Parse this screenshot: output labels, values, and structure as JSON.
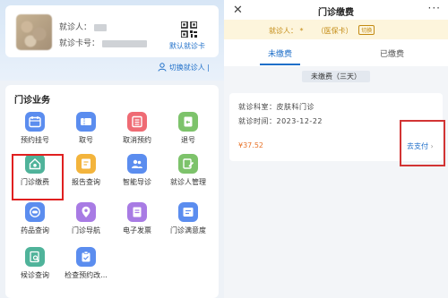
{
  "left": {
    "patient": {
      "name_label": "就诊人：",
      "card_label": "就诊卡号：",
      "qr_label": "默认就诊卡"
    },
    "switch_patient": "切换就诊人",
    "services_title": "门诊业务",
    "services": [
      {
        "label": "预约挂号",
        "icon": "calendar-icon",
        "color": "#5b8def"
      },
      {
        "label": "取号",
        "icon": "ticket-icon",
        "color": "#5b8def"
      },
      {
        "label": "取消预约",
        "icon": "list-icon",
        "color": "#ef6b74"
      },
      {
        "label": "退号",
        "icon": "document-return-icon",
        "color": "#7dc36b"
      },
      {
        "label": "门诊缴费",
        "icon": "house-payment-icon",
        "color": "#4fb39a"
      },
      {
        "label": "报告查询",
        "icon": "report-icon",
        "color": "#f3b43c"
      },
      {
        "label": "智能导诊",
        "icon": "people-icon",
        "color": "#5b8def"
      },
      {
        "label": "就诊人管理",
        "icon": "edit-icon",
        "color": "#7dc36b"
      },
      {
        "label": "药品查询",
        "icon": "pill-icon",
        "color": "#5b8def"
      },
      {
        "label": "门诊导航",
        "icon": "location-pin-icon",
        "color": "#a87be4"
      },
      {
        "label": "电子发票",
        "icon": "invoice-icon",
        "color": "#a87be4"
      },
      {
        "label": "门诊满意度",
        "icon": "survey-icon",
        "color": "#5b8def"
      },
      {
        "label": "候诊查询",
        "icon": "search-document-icon",
        "color": "#4fb39a"
      },
      {
        "label": "检查预约改...",
        "icon": "clipboard-icon",
        "color": "#5b8def"
      }
    ]
  },
  "right": {
    "title": "门诊缴费",
    "banner": {
      "prefix": "就诊人：",
      "masked": "*",
      "card_type": "（医保卡）",
      "switch_label": "切换"
    },
    "tabs": [
      {
        "label": "未缴费",
        "active": true
      },
      {
        "label": "已缴费",
        "active": false
      }
    ],
    "filter_label": "未缴费（三天）",
    "order": {
      "department_label": "就诊科室：",
      "department": "皮肤科门诊",
      "date_label": "就诊时间：",
      "date": "2023-12-22",
      "amount": "¥37.52",
      "pay_label": "去支付"
    }
  },
  "colors": {
    "accent": "#1f6fc9",
    "highlight_box": "#e02020",
    "amount": "#e8732a",
    "banner_bg": "#fdf5dc",
    "banner_text": "#c38a12"
  }
}
